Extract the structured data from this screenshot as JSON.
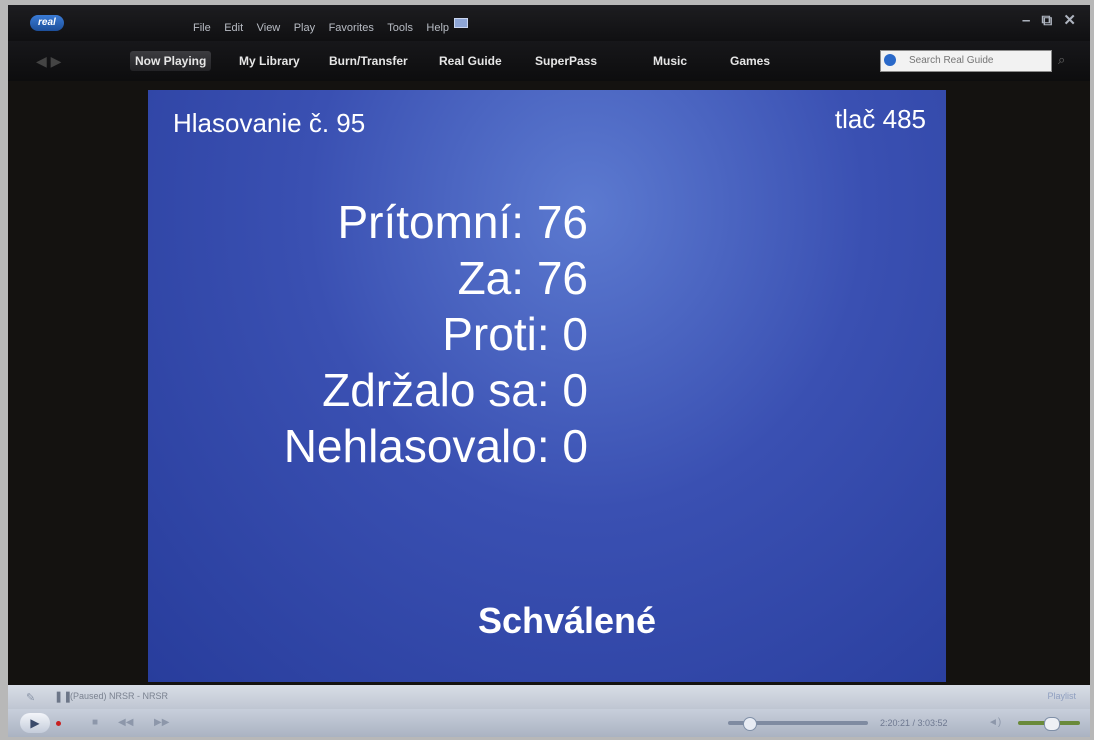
{
  "app": {
    "logo_text": "real"
  },
  "menu": [
    "File",
    "Edit",
    "View",
    "Play",
    "Favorites",
    "Tools",
    "Help"
  ],
  "window_controls": {
    "minimize": "–",
    "restore": "⧉",
    "close": "✕"
  },
  "nav": {
    "tabs": [
      "Now Playing",
      "My Library",
      "Burn/Transfer",
      "Real Guide",
      "SuperPass",
      "Music",
      "Games"
    ],
    "active_tab": "Now Playing",
    "search_placeholder": "Search Real Guide"
  },
  "screen": {
    "vote_number": "Hlasovanie č. 95",
    "print_number": "tlač 485",
    "stats": [
      {
        "label": "Prítomní:",
        "value": "76"
      },
      {
        "label": "Za:",
        "value": "76"
      },
      {
        "label": "Proti:",
        "value": "0"
      },
      {
        "label": "Zdržalo sa:",
        "value": "0"
      },
      {
        "label": "Nehlasovalo:",
        "value": "0"
      }
    ],
    "result": "Schválené"
  },
  "statusbar": {
    "state_text": "(Paused) NRSR - NRSR",
    "playlist_label": "Playlist"
  },
  "controls": {
    "time": "2:20:21 / 3:03:52",
    "seek_fraction": 0.76,
    "volume_fraction": 0.45
  },
  "colors": {
    "screen_blue": "#3a50b2",
    "app_dark": "#141210",
    "control_bar": "#c8cfdb"
  }
}
